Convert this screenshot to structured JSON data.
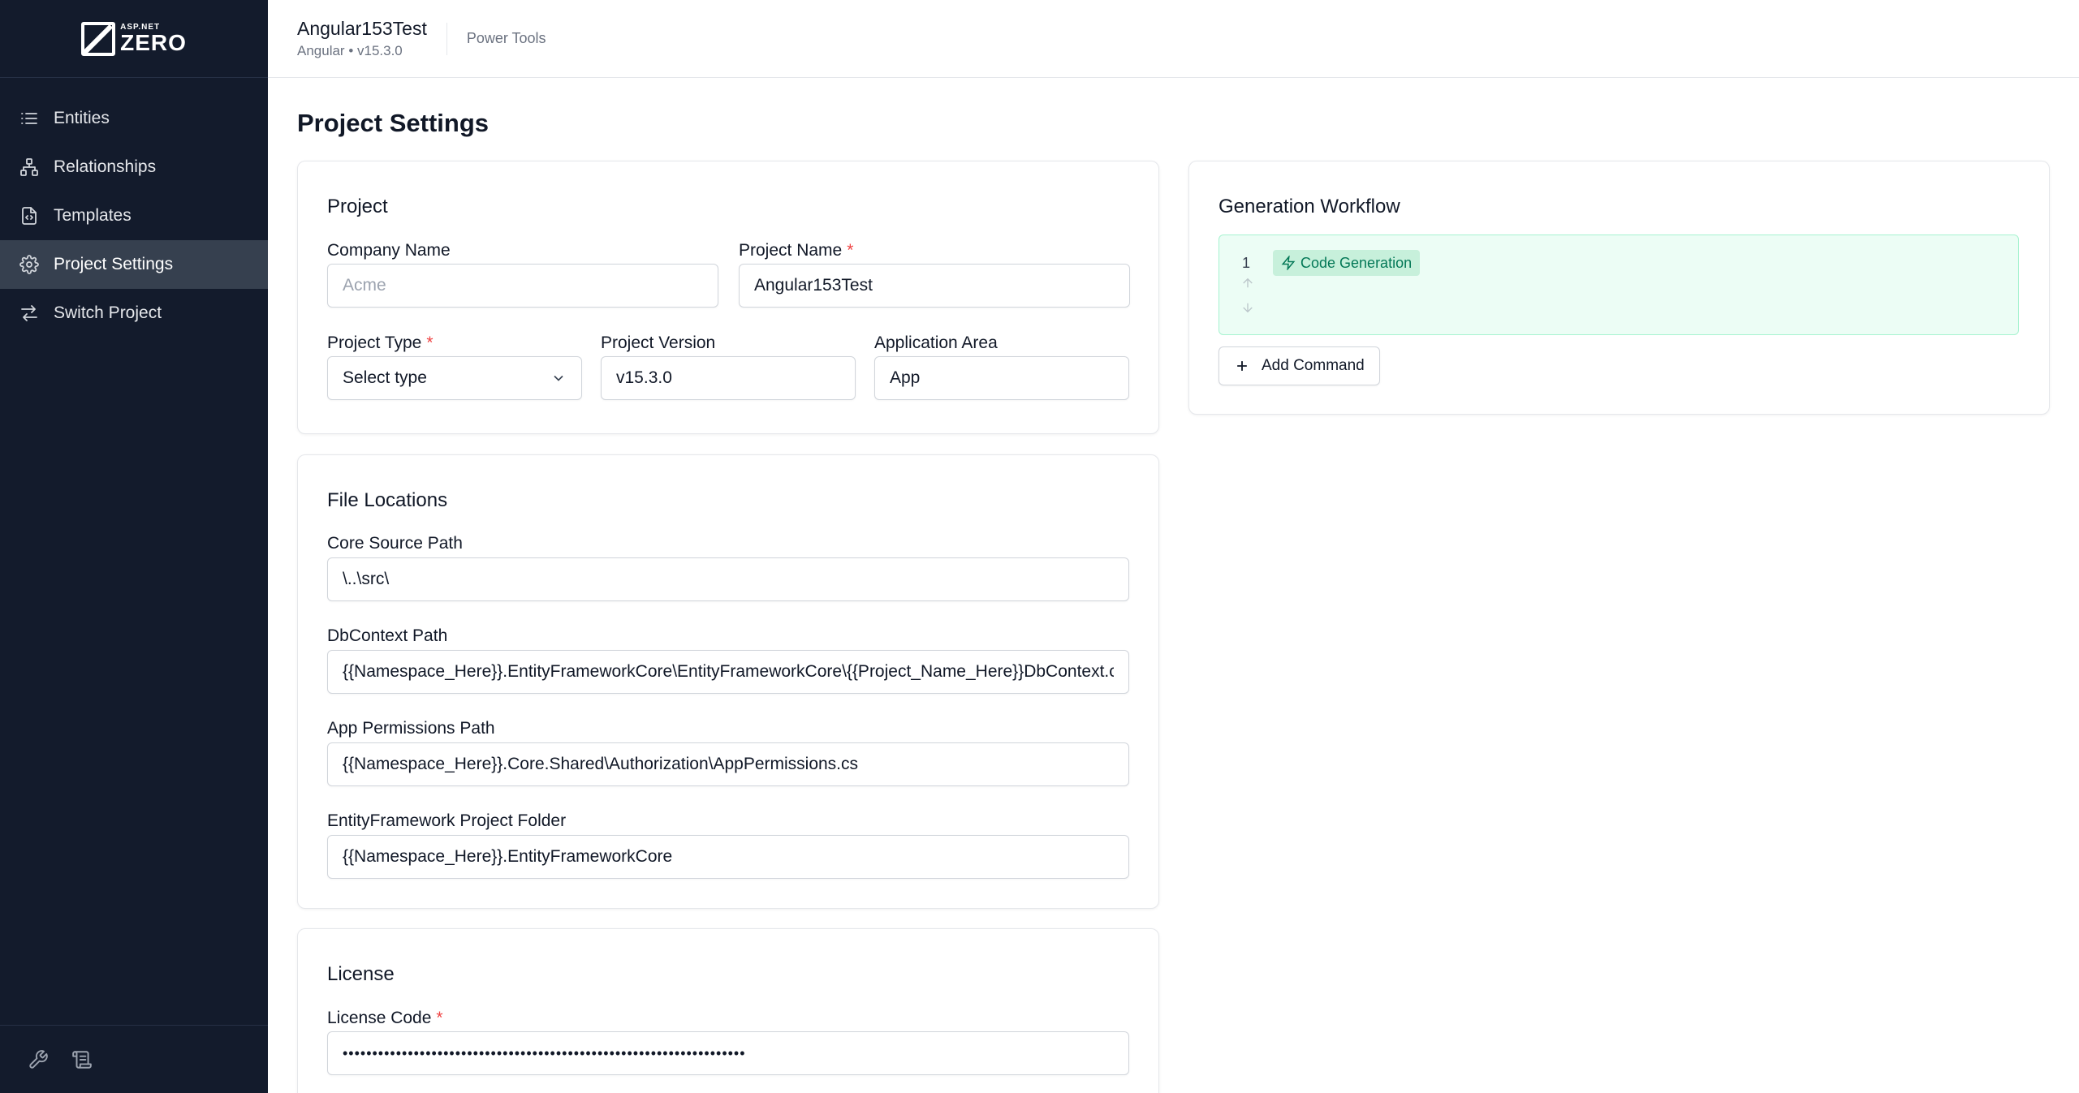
{
  "logo": {
    "small": "ASP.NET",
    "big": "ZERO"
  },
  "sidebar": {
    "items": [
      {
        "label": "Entities",
        "icon": "list-icon"
      },
      {
        "label": "Relationships",
        "icon": "hierarchy-icon"
      },
      {
        "label": "Templates",
        "icon": "file-code-icon"
      },
      {
        "label": "Project Settings",
        "icon": "gear-icon",
        "active": true
      },
      {
        "label": "Switch Project",
        "icon": "switch-arrows-icon"
      }
    ],
    "footer_icons": [
      "wrench-icon",
      "scroll-icon"
    ]
  },
  "header": {
    "project_name": "Angular153Test",
    "project_sub": "Angular • v15.3.0",
    "section": "Power Tools"
  },
  "page": {
    "title": "Project Settings"
  },
  "project_card": {
    "title": "Project",
    "company_name_label": "Company Name",
    "company_name_placeholder": "Acme",
    "company_name_value": "",
    "project_name_label": "Project Name",
    "project_name_value": "Angular153Test",
    "project_type_label": "Project Type",
    "project_type_value": "Select type",
    "project_version_label": "Project Version",
    "project_version_value": "v15.3.0",
    "application_area_label": "Application Area",
    "application_area_value": "App",
    "required_mark": "*"
  },
  "file_locations": {
    "title": "File Locations",
    "core_source_label": "Core Source Path",
    "core_source_value": "\\..\\src\\",
    "dbcontext_label": "DbContext Path",
    "dbcontext_value": "{{Namespace_Here}}.EntityFrameworkCore\\EntityFrameworkCore\\{{Project_Name_Here}}DbContext.cs",
    "permissions_label": "App Permissions Path",
    "permissions_value": "{{Namespace_Here}}.Core.Shared\\Authorization\\AppPermissions.cs",
    "ef_folder_label": "EntityFramework Project Folder",
    "ef_folder_value": "{{Namespace_Here}}.EntityFrameworkCore"
  },
  "license": {
    "title": "License",
    "code_label": "License Code",
    "code_value": "••••••••••••••••••••••••••••••••••••••••••••••••••••••••••••••••••••"
  },
  "workflow": {
    "title": "Generation Workflow",
    "step_number": "1",
    "step_label": "Code Generation",
    "add_command_label": "Add Command"
  },
  "colors": {
    "sidebar_bg": "#131b2c",
    "active_item_bg": "#36404f",
    "workflow_bg": "#ecfdf5",
    "badge_text": "#047857",
    "required": "#ef4444"
  }
}
